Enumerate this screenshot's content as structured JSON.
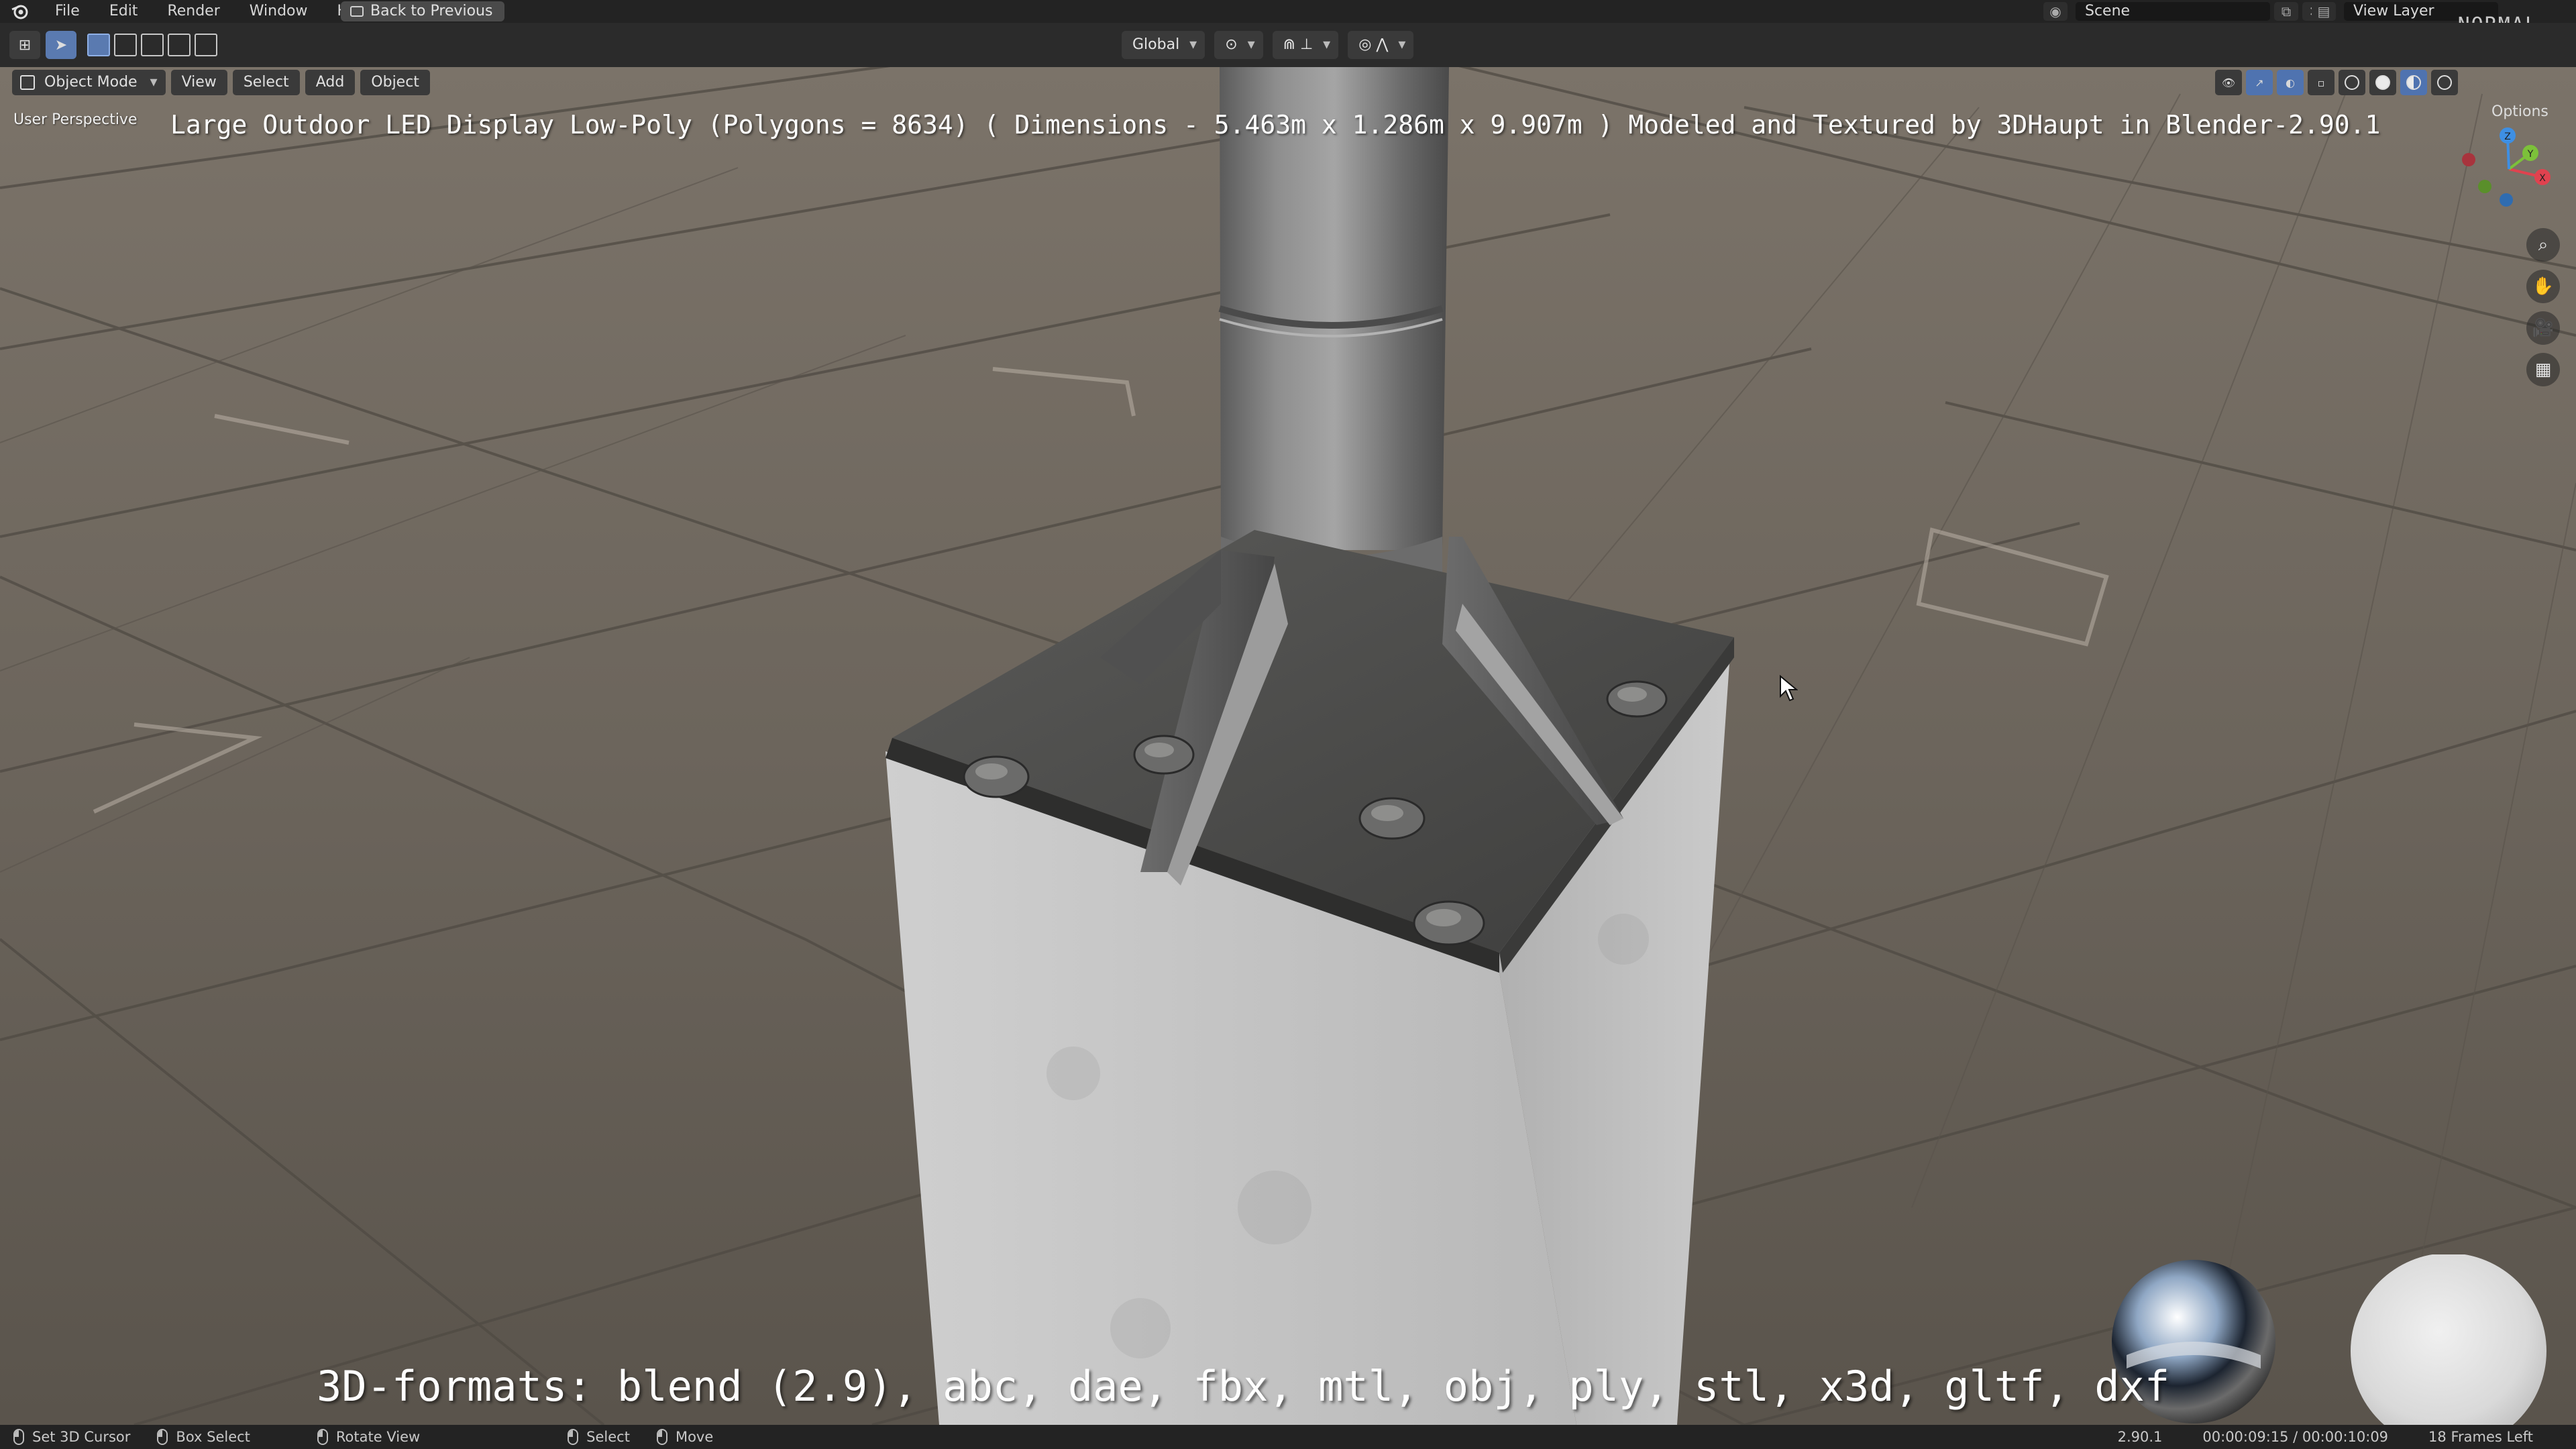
{
  "menu": {
    "items": [
      "File",
      "Edit",
      "Render",
      "Window",
      "Help"
    ],
    "back_button": "Back to Previous"
  },
  "scene": {
    "name": "Scene",
    "view_layer": "View Layer",
    "overlay_mode_tag": "NORMAL"
  },
  "header": {
    "transform_orientation": "Global"
  },
  "viewport": {
    "mode": "Object Mode",
    "menus": [
      "View",
      "Select",
      "Add",
      "Object"
    ],
    "perspective_label": "User Perspective",
    "options_label": "Options",
    "title_overlay": "Large Outdoor LED Display Low-Poly (Polygons = 8634) ( Dimensions -  5.463m x 1.286m x 9.907m ) Modeled and Textured by 3DHaupt in Blender-2.90.1",
    "formats_overlay": "3D-formats: blend (2.9), abc, dae, fbx, mtl, obj, ply, stl, x3d, gltf, dxf"
  },
  "gizmo": {
    "x_label": "X",
    "y_label": "Y",
    "z_label": "Z",
    "colors": {
      "x": "#e0424f",
      "y": "#7cc13a",
      "z": "#3e8fe3"
    }
  },
  "statusbar": {
    "left": [
      "Set 3D Cursor",
      "Box Select",
      "Rotate View",
      "Select",
      "Move"
    ],
    "version": "2.90.1",
    "timecode": "00:00:09:15 / 00:00:10:09",
    "frames_left": "18 Frames Left"
  }
}
